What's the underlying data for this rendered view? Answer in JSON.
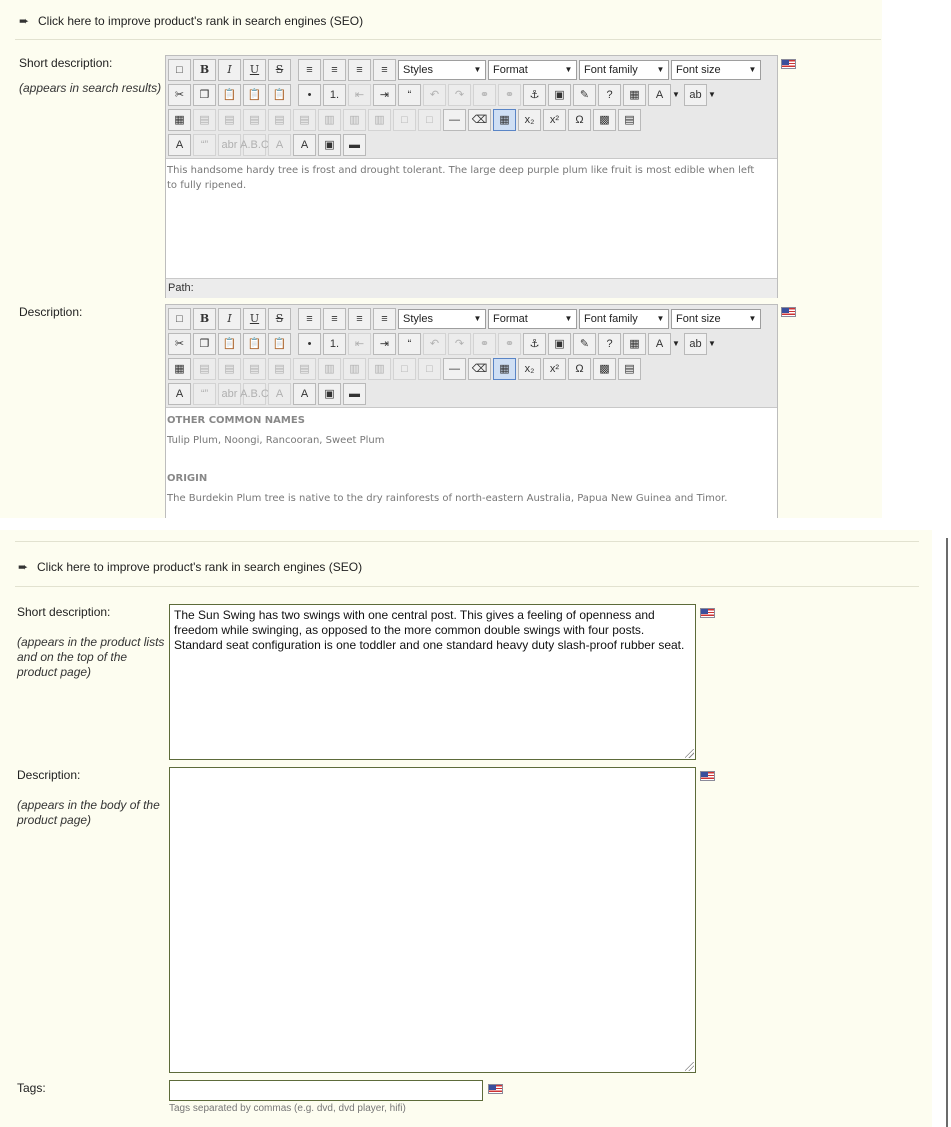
{
  "seo": {
    "link_label": "Click here to improve product's rank in search engines (SEO)"
  },
  "editor": {
    "dropdowns": {
      "styles": "Styles",
      "format": "Format",
      "font_family": "Font family",
      "font_size": "Font size"
    },
    "path_label": "Path:",
    "buttons": {
      "bold": "B",
      "italic": "I",
      "underline": "U",
      "strikethrough": "S",
      "blockquote": "“",
      "hr": "—",
      "sub": "x₂",
      "sup": "x²",
      "charmap": "Ω",
      "font_color": "A",
      "spell": "ab",
      "style_props": "A",
      "cite": "“”",
      "abbr": "abr",
      "acronym": "A.B.C",
      "del": "A",
      "ins": "A"
    }
  },
  "top": {
    "short_desc": {
      "label": "Short description:",
      "hint": "(appears in search results)",
      "content": [
        "This handsome hardy tree is frost and drought tolerant. The large deep purple plum like fruit is most edible when left",
        "to fully ripened."
      ]
    },
    "description": {
      "label": "Description:",
      "heading1": "OTHER COMMON NAMES",
      "text1": "Tulip Plum, Noongi, Rancooran, Sweet Plum",
      "heading2": "ORIGIN",
      "text2": "The Burdekin Plum tree is native to the dry rainforests of north-eastern Australia, Papua New Guinea and Timor."
    }
  },
  "bottom": {
    "short_desc": {
      "label": "Short description:",
      "hint_lines": [
        "(appears in the product lists",
        "and on the top of the",
        "product page)"
      ],
      "value": "The Sun Swing has two swings with one central post. This gives a feeling of openness and freedom while swinging, as opposed to the more common double swings with four posts. Standard seat configuration is one toddler and one standard heavy duty slash-proof rubber seat."
    },
    "description": {
      "label": "Description:",
      "hint_lines": [
        "(appears in the body of the",
        "product page)"
      ],
      "value": ""
    },
    "tags": {
      "label": "Tags:",
      "value": "",
      "hint": "Tags separated by commas (e.g. dvd, dvd player, hifi)"
    }
  }
}
